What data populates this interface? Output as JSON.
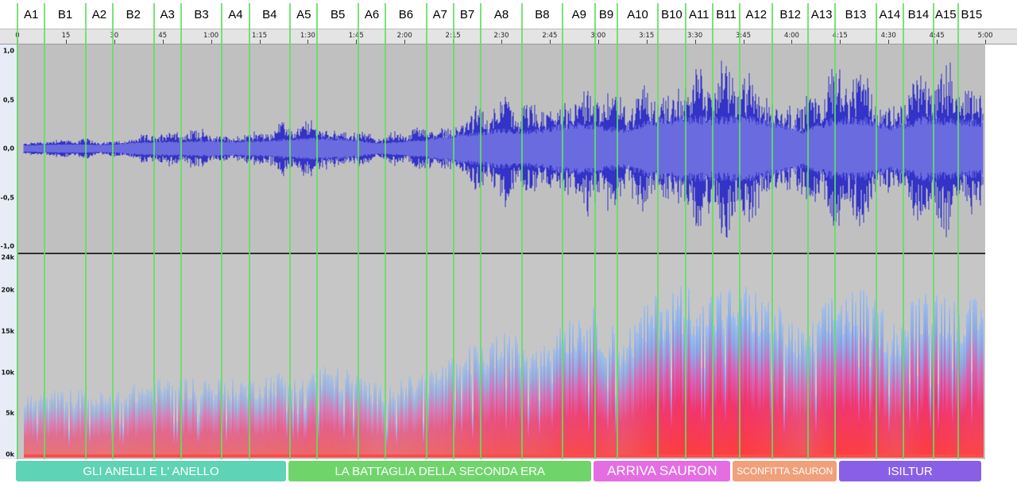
{
  "segments": [
    {
      "label": "A1",
      "time": 0,
      "end": 10
    },
    {
      "label": "B1",
      "time": 10,
      "end": 25
    },
    {
      "label": "A2",
      "time": 25,
      "end": 35
    },
    {
      "label": "B2",
      "time": 35,
      "end": 50
    },
    {
      "label": "A3",
      "time": 50,
      "end": 60
    },
    {
      "label": "B3",
      "time": 60,
      "end": 75
    },
    {
      "label": "A4",
      "time": 75,
      "end": 85
    },
    {
      "label": "B4",
      "time": 85,
      "end": 100
    },
    {
      "label": "A5",
      "time": 100,
      "end": 110
    },
    {
      "label": "B5",
      "time": 110,
      "end": 125
    },
    {
      "label": "A6",
      "time": 125,
      "end": 135
    },
    {
      "label": "B6",
      "time": 135,
      "end": 150
    },
    {
      "label": "A7",
      "time": 150,
      "end": 160
    },
    {
      "label": "B7",
      "time": 160,
      "end": 170
    },
    {
      "label": "A8",
      "time": 170,
      "end": 185
    },
    {
      "label": "B8",
      "time": 185,
      "end": 200
    },
    {
      "label": "A9",
      "time": 200,
      "end": 212
    },
    {
      "label": "B9",
      "time": 212,
      "end": 220
    },
    {
      "label": "A10",
      "time": 220,
      "end": 235
    },
    {
      "label": "B10",
      "time": 235,
      "end": 245
    },
    {
      "label": "A11",
      "time": 245,
      "end": 255
    },
    {
      "label": "B11",
      "time": 255,
      "end": 265
    },
    {
      "label": "A12",
      "time": 265,
      "end": 277
    },
    {
      "label": "B12",
      "time": 277,
      "end": 290
    },
    {
      "label": "A13",
      "time": 290,
      "end": 300
    },
    {
      "label": "B13",
      "time": 300,
      "end": 315
    },
    {
      "label": "A14",
      "time": 315,
      "end": 325
    },
    {
      "label": "B14",
      "time": 325,
      "end": 336
    },
    {
      "label": "A15",
      "time": 336,
      "end": 345
    },
    {
      "label": "B15",
      "time": 345,
      "end": 355
    }
  ],
  "ruler": {
    "ticks": [
      {
        "label": "0",
        "t": 0
      },
      {
        "label": "15",
        "t": 15
      },
      {
        "label": "30",
        "t": 30
      },
      {
        "label": "45",
        "t": 45
      },
      {
        "label": "1:00",
        "t": 60
      },
      {
        "label": "1:15",
        "t": 75
      },
      {
        "label": "1:30",
        "t": 90
      },
      {
        "label": "1:45",
        "t": 105
      },
      {
        "label": "2:00",
        "t": 120
      },
      {
        "label": "2:15",
        "t": 135
      },
      {
        "label": "2:30",
        "t": 150
      },
      {
        "label": "2:45",
        "t": 165
      },
      {
        "label": "3:00",
        "t": 180
      },
      {
        "label": "3:15",
        "t": 195
      },
      {
        "label": "3:30",
        "t": 210
      },
      {
        "label": "3:45",
        "t": 225
      },
      {
        "label": "4:00",
        "t": 240
      },
      {
        "label": "4:15",
        "t": 255
      },
      {
        "label": "4:30",
        "t": 270
      },
      {
        "label": "4:45",
        "t": 285
      },
      {
        "label": "5:00",
        "t": 300
      }
    ],
    "min_seconds": 0,
    "max_seconds": 300
  },
  "waveform_axis": {
    "labels": [
      "1,0",
      "0,5",
      "0,0",
      "-0,5",
      "-1,0"
    ],
    "values": [
      1.0,
      0.5,
      0.0,
      -0.5,
      -1.0
    ]
  },
  "spectrogram_axis": {
    "labels": [
      "24k",
      "20k",
      "15k",
      "10k",
      "5k",
      "0k"
    ],
    "values": [
      24000,
      20000,
      15000,
      10000,
      5000,
      0
    ]
  },
  "sections": [
    {
      "label": "GLI  ANELLI E  L' ANELLO",
      "start": 0,
      "end": 100,
      "color": "#5fd3b5",
      "font": "15px"
    },
    {
      "label": "LA BATTAGLIA  DELLA SECONDA ERA",
      "start": 100,
      "end": 212,
      "color": "#6fd56b",
      "font": "15px"
    },
    {
      "label": "ARRIVA SAURON",
      "start": 212,
      "end": 263,
      "color": "#e56de4",
      "font": "17px"
    },
    {
      "label": "SCONFITTA SAURON",
      "start": 263,
      "end": 302,
      "color": "#f0a07a",
      "font": "12px"
    },
    {
      "label": "ISILTUR",
      "start": 302,
      "end": 355,
      "color": "#8a5fe8",
      "font": "15px"
    }
  ],
  "colors": {
    "waveform": "#3333c8",
    "waveform_rms": "#6b6be0",
    "background": "#c0c0c0",
    "boundary": "#5fe05f"
  },
  "loudness": [
    0.05,
    0.08,
    0.09,
    0.07,
    0.15,
    0.18,
    0.2,
    0.17,
    0.2,
    0.26,
    0.3,
    0.25,
    0.12,
    0.2,
    0.3,
    0.45,
    0.55,
    0.5,
    0.7,
    0.75,
    0.55,
    0.85,
    0.95,
    0.9,
    0.95,
    0.8,
    0.55,
    0.9,
    0.9,
    0.65,
    0.95,
    0.85,
    0.8
  ]
}
